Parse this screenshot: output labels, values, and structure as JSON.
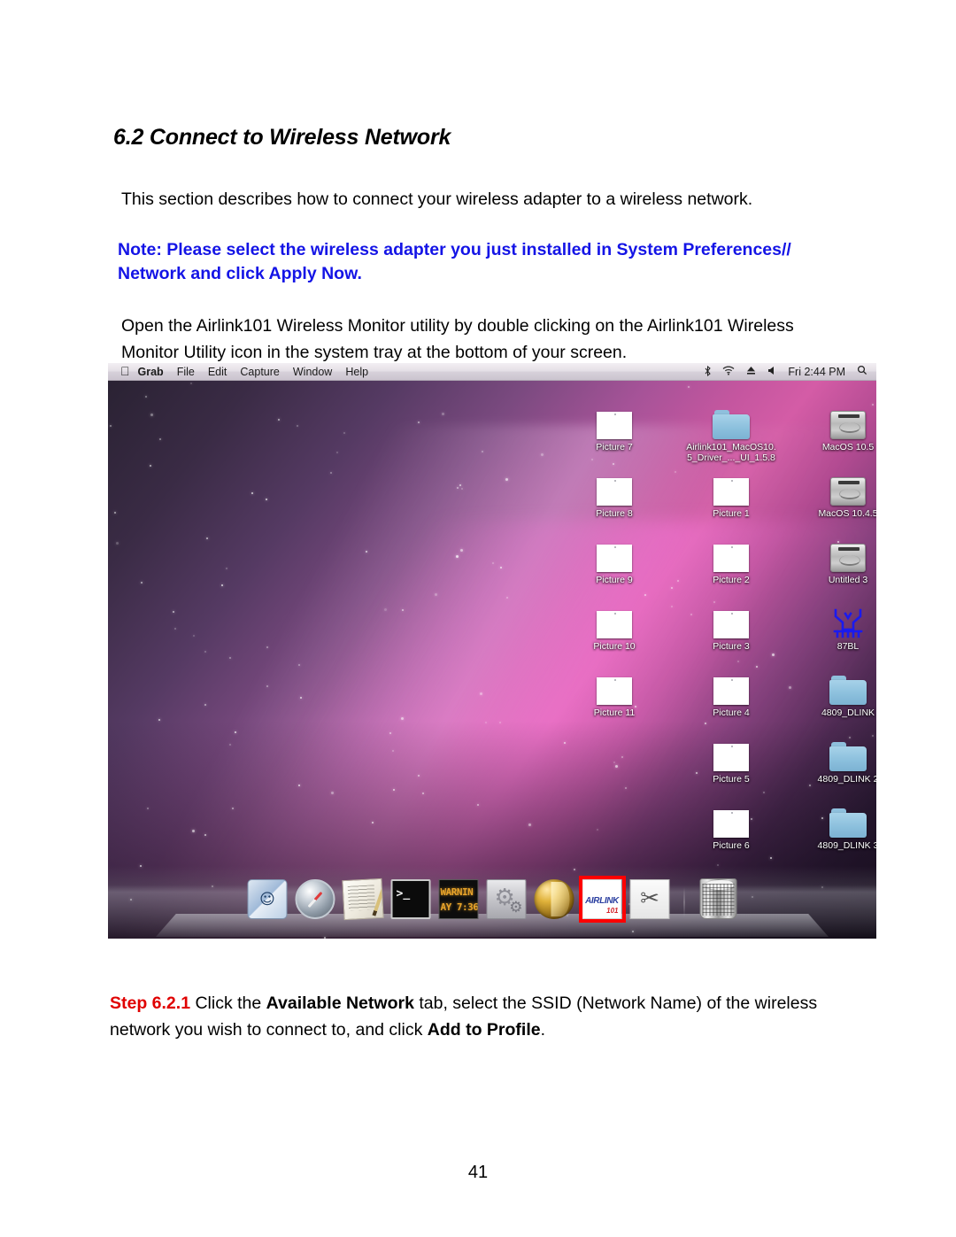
{
  "document": {
    "heading": "6.2 Connect to Wireless Network",
    "intro_paragraph": "This section describes how to connect your wireless adapter to a wireless network.",
    "note": "Note: Please select the wireless adapter you just installed in System Preferences// Network and click Apply Now.",
    "note_color": "#1414e6",
    "open_paragraph": "Open the Airlink101 Wireless Monitor utility by double clicking on the Airlink101 Wireless Monitor Utility icon in the system tray at the bottom of your screen.",
    "step": {
      "number": "Step 6.2.1",
      "number_color": "#e00000",
      "text_1": " Click the ",
      "bold_1": "Available Network",
      "text_2": " tab, select the SSID (Network Name) of the wireless network you wish to connect to, and click ",
      "bold_2": "Add to Profile",
      "text_3": "."
    },
    "page_number": "41"
  },
  "screenshot": {
    "menubar": {
      "apple_glyph": "",
      "items": [
        {
          "label": "Grab",
          "app": true
        },
        {
          "label": "File",
          "app": false
        },
        {
          "label": "Edit",
          "app": false
        },
        {
          "label": "Capture",
          "app": false
        },
        {
          "label": "Window",
          "app": false
        },
        {
          "label": "Help",
          "app": false
        }
      ],
      "status": {
        "bluetooth_icon": "ᛗ",
        "airport_icon": "◠",
        "eject_icon": "⏏",
        "volume_icon": "◀",
        "clock": "Fri 2:44 PM",
        "search_icon": "⌕"
      }
    },
    "desktop_icons": [
      {
        "label": "Picture 7",
        "type": "picture",
        "col": 0,
        "row": 0
      },
      {
        "label": "Picture 8",
        "type": "picture",
        "col": 0,
        "row": 1
      },
      {
        "label": "Picture 9",
        "type": "picture",
        "col": 0,
        "row": 2
      },
      {
        "label": "Picture 10",
        "type": "picture",
        "col": 0,
        "row": 3
      },
      {
        "label": "Picture 11",
        "type": "picture",
        "col": 0,
        "row": 4
      },
      {
        "label": "Airlink101_MacOS10.\n5_Driver_..._UI_1.5.8",
        "type": "folder",
        "col": 1,
        "row": 0
      },
      {
        "label": "Picture 1",
        "type": "picture",
        "col": 1,
        "row": 1
      },
      {
        "label": "Picture 2",
        "type": "picture",
        "col": 1,
        "row": 2
      },
      {
        "label": "Picture 3",
        "type": "picture",
        "col": 1,
        "row": 3
      },
      {
        "label": "Picture 4",
        "type": "picture",
        "col": 1,
        "row": 4
      },
      {
        "label": "Picture 5",
        "type": "picture",
        "col": 1,
        "row": 5
      },
      {
        "label": "Picture 6",
        "type": "picture",
        "col": 1,
        "row": 6
      },
      {
        "label": "MacOS 10.5",
        "type": "disk",
        "col": 2,
        "row": 0
      },
      {
        "label": "MacOS 10.4.5",
        "type": "disk",
        "col": 2,
        "row": 1
      },
      {
        "label": "Untitled 3",
        "type": "disk",
        "col": 2,
        "row": 2
      },
      {
        "label": "87BL",
        "type": "circuit",
        "col": 2,
        "row": 3
      },
      {
        "label": "4809_DLINK",
        "type": "folder",
        "col": 2,
        "row": 4
      },
      {
        "label": "4809_DLINK 2",
        "type": "folder",
        "col": 2,
        "row": 5
      },
      {
        "label": "4809_DLINK 3",
        "type": "folder",
        "col": 2,
        "row": 6
      }
    ],
    "dock": {
      "items": [
        {
          "name": "finder",
          "label": "Finder"
        },
        {
          "name": "safari",
          "label": "Safari"
        },
        {
          "name": "textedit",
          "label": "TextEdit"
        },
        {
          "name": "terminal",
          "label": "Terminal",
          "prompt": ">_"
        },
        {
          "name": "warning-display",
          "label": "Warning Display",
          "line1": "WARNIN",
          "line2": "AY 7:36"
        },
        {
          "name": "system-preferences",
          "label": "System Preferences"
        },
        {
          "name": "gold-app",
          "label": "Application"
        },
        {
          "name": "airlink101-wireless-monitor",
          "label": "Airlink101 Wireless Monitor",
          "brand": "AIRLINK",
          "number": "101",
          "highlighted": true
        },
        {
          "name": "grab",
          "label": "Grab"
        },
        {
          "name": "trash",
          "label": "Trash"
        }
      ],
      "highlight_color": "#ff0000"
    }
  }
}
